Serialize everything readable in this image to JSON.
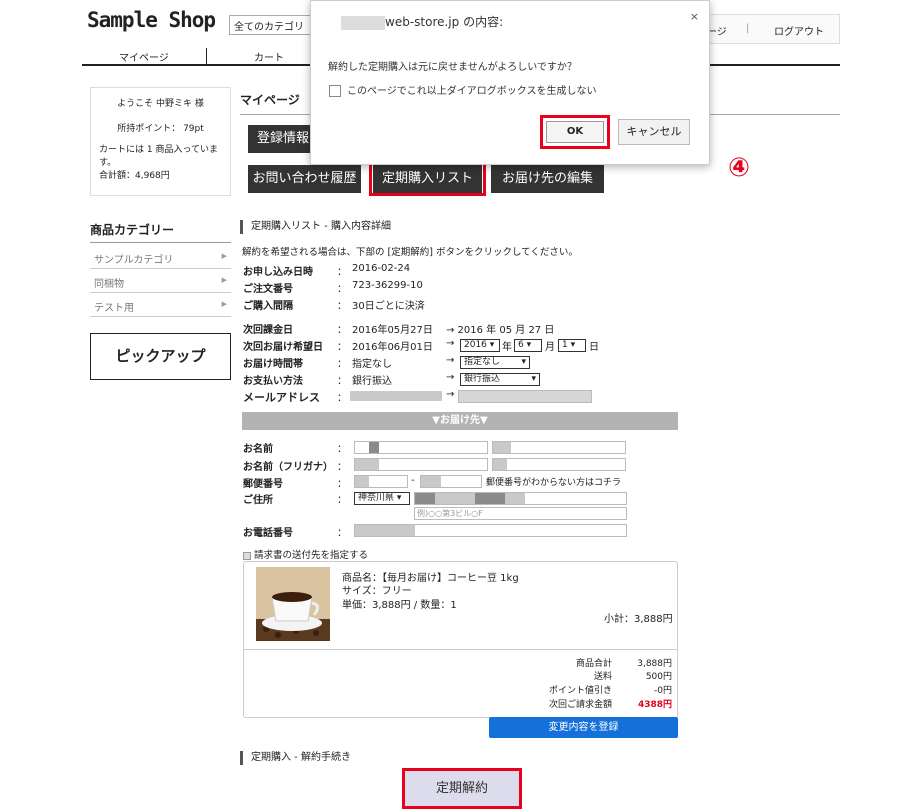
{
  "header": {
    "logo": "Sample Shop",
    "category_select": "全てのカテゴリ",
    "mypage_partial": "ージ",
    "logout": "ログアウト",
    "nav": [
      "マイページ",
      "カート"
    ]
  },
  "sidebar": {
    "welcome": "ようこそ 中野ミキ 様",
    "points": "所持ポイント： 79pt",
    "cart_info": "カートには 1 商品入っています。",
    "cart_total": "合計額：4,968円",
    "category_title": "商品カテゴリー",
    "categories": [
      "サンプルカテゴリ",
      "同梱物",
      "テスト用"
    ],
    "pickup": "ピックアップ"
  },
  "main": {
    "title": "マイページ",
    "btn_register": "登録情報",
    "btn_contact": "お問い合わせ履歴",
    "btn_subscription": "定期購入リスト",
    "btn_delivery": "お届け先の編集",
    "section_detail": "定期購入リスト - 購入内容詳細",
    "instruction": "解約を希望される場合は、下部の [定期解約] ボタンをクリックしてください。",
    "rows": [
      {
        "label": "お申し込み日時",
        "value": "2016-02-24"
      },
      {
        "label": "ご注文番号",
        "value": "723-36299-10"
      },
      {
        "label": "ご購入間隔",
        "value": "30日ごとに決済"
      }
    ],
    "next_billing": {
      "label": "次回課金日",
      "value": "2016年05月27日",
      "arrow_value": "→ 2016 年 05 月 27 日"
    },
    "next_delivery": {
      "label": "次回お届け希望日",
      "value": "2016年06月01日",
      "year": "2016",
      "y_unit": "年",
      "month": "6",
      "m_unit": "月",
      "day": "1",
      "d_unit": "日"
    },
    "delivery_time": {
      "label": "お届け時間帯",
      "value": "指定なし",
      "select": "指定なし"
    },
    "payment": {
      "label": "お支払い方法",
      "value": "銀行振込",
      "select": "銀行振込"
    },
    "email": {
      "label": "メールアドレス"
    },
    "delivery_bar": "▼お届け先▼",
    "addr_rows": [
      {
        "label": "お名前"
      },
      {
        "label": "お名前（フリガナ）"
      },
      {
        "label": "郵便番号"
      },
      {
        "label": "ご住所"
      },
      {
        "label": "お電話番号"
      }
    ],
    "colon": "：",
    "arrow": "→",
    "postal_note": "郵便番号がわからない方はコチラ",
    "pref_select": "神奈川県",
    "addr_placeholder": "例)○○第3ビル○F",
    "invoice_check": "請求書の送付先を指定する",
    "product": {
      "name": "商品名：【毎月お届け】コーヒー豆 1kg",
      "size": "サイズ：フリー",
      "price": "単価：3,888円 / 数量：1",
      "subtotal": "小計：3,888円"
    },
    "totals": [
      {
        "label": "商品合計",
        "value": "3,888円"
      },
      {
        "label": "送料",
        "value": "500円"
      },
      {
        "label": "ポイント値引き",
        "value": "-0円"
      },
      {
        "label": "次回ご請求金額",
        "value": "4388円"
      }
    ],
    "update_btn": "変更内容を登録",
    "section_cancel": "定期購入 - 解約手続き",
    "cancel_btn": "定期解約"
  },
  "step_marker": "④",
  "dialog": {
    "host": "web-store.jp の内容:",
    "close": "×",
    "message": "解約した定期購入は元に戻せませんがよろしいですか？",
    "checkbox": "このページでこれ以上ダイアログボックスを生成しない",
    "ok": "OK",
    "cancel": "キャンセル"
  },
  "colors": {
    "accent_red": "#e8001c",
    "update_blue": "#1571d9",
    "dark_button": "#333333"
  }
}
